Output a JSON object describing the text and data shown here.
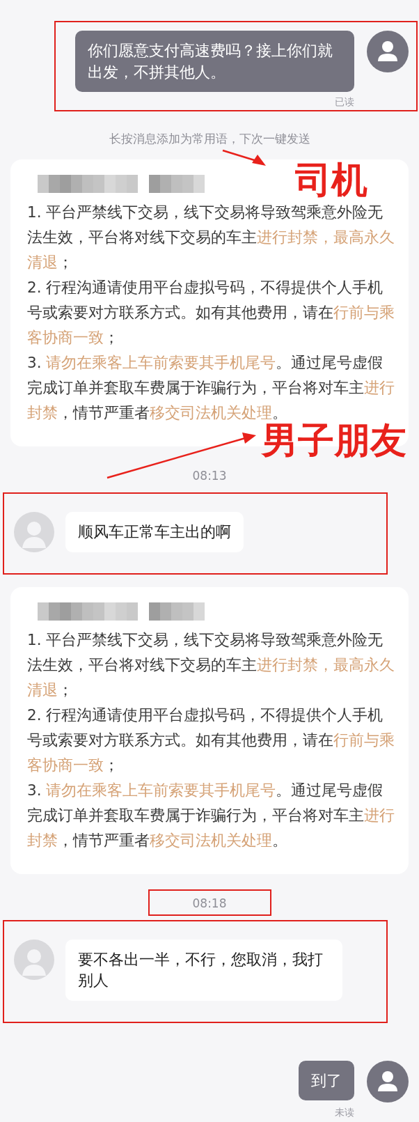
{
  "messages": [
    {
      "kind": "outgoing",
      "text": "你们愿意支付高速费吗？接上你们就出发，不拼其他人。",
      "receipt": "已读",
      "highlighted": true
    },
    {
      "kind": "hint",
      "text": "长按消息添加为常用语，下次一键发送"
    },
    {
      "kind": "notice",
      "paragraphs": [
        [
          {
            "text": "1. 平台严禁线下交易，线下交易将导致驾乘意外险无法生效，平台将对线下交易的车主",
            "accent": false
          },
          {
            "text": "进行封禁，最高永久清退",
            "accent": true
          },
          {
            "text": "；",
            "accent": false
          }
        ],
        [
          {
            "text": "2. 行程沟通请使用平台虚拟号码，不得提供个人手机号或索要对方联系方式。如有其他费用，请在",
            "accent": false
          },
          {
            "text": "行前与乘客协商一致",
            "accent": true
          },
          {
            "text": "；",
            "accent": false
          }
        ],
        [
          {
            "text": "3. ",
            "accent": false
          },
          {
            "text": "请勿在乘客上车前索要其手机尾号",
            "accent": true
          },
          {
            "text": "。通过尾号虚假完成订单并套取车费属于诈骗行为，平台将对车主",
            "accent": false
          },
          {
            "text": "进行封禁",
            "accent": true
          },
          {
            "text": "，情节严重者",
            "accent": false
          },
          {
            "text": "移交司法机关处理",
            "accent": true
          },
          {
            "text": "。",
            "accent": false
          }
        ]
      ]
    },
    {
      "kind": "time",
      "text": "08:13",
      "highlighted": false
    },
    {
      "kind": "incoming",
      "text": "顺风车正常车主出的啊",
      "highlighted": true
    },
    {
      "kind": "notice",
      "paragraphs": [
        [
          {
            "text": "1. 平台严禁线下交易，线下交易将导致驾乘意外险无法生效，平台将对线下交易的车主",
            "accent": false
          },
          {
            "text": "进行封禁，最高永久清退",
            "accent": true
          },
          {
            "text": "；",
            "accent": false
          }
        ],
        [
          {
            "text": "2. 行程沟通请使用平台虚拟号码，不得提供个人手机号或索要对方联系方式。如有其他费用，请在",
            "accent": false
          },
          {
            "text": "行前与乘客协商一致",
            "accent": true
          },
          {
            "text": "；",
            "accent": false
          }
        ],
        [
          {
            "text": "3. ",
            "accent": false
          },
          {
            "text": "请勿在乘客上车前索要其手机尾号",
            "accent": true
          },
          {
            "text": "。通过尾号虚假完成订单并套取车费属于诈骗行为，平台将对车主",
            "accent": false
          },
          {
            "text": "进行封禁",
            "accent": true
          },
          {
            "text": "，情节严重者",
            "accent": false
          },
          {
            "text": "移交司法机关处理",
            "accent": true
          },
          {
            "text": "。",
            "accent": false
          }
        ]
      ]
    },
    {
      "kind": "time",
      "text": "08:18",
      "highlighted": true
    },
    {
      "kind": "incoming",
      "text": "要不各出一半，不行，您取消，我打别人",
      "highlighted": true
    },
    {
      "kind": "outgoing",
      "text": "到了",
      "receipt": "未读",
      "highlighted": false
    }
  ],
  "annotations": [
    {
      "text": "司机"
    },
    {
      "text": "男子朋友"
    }
  ]
}
